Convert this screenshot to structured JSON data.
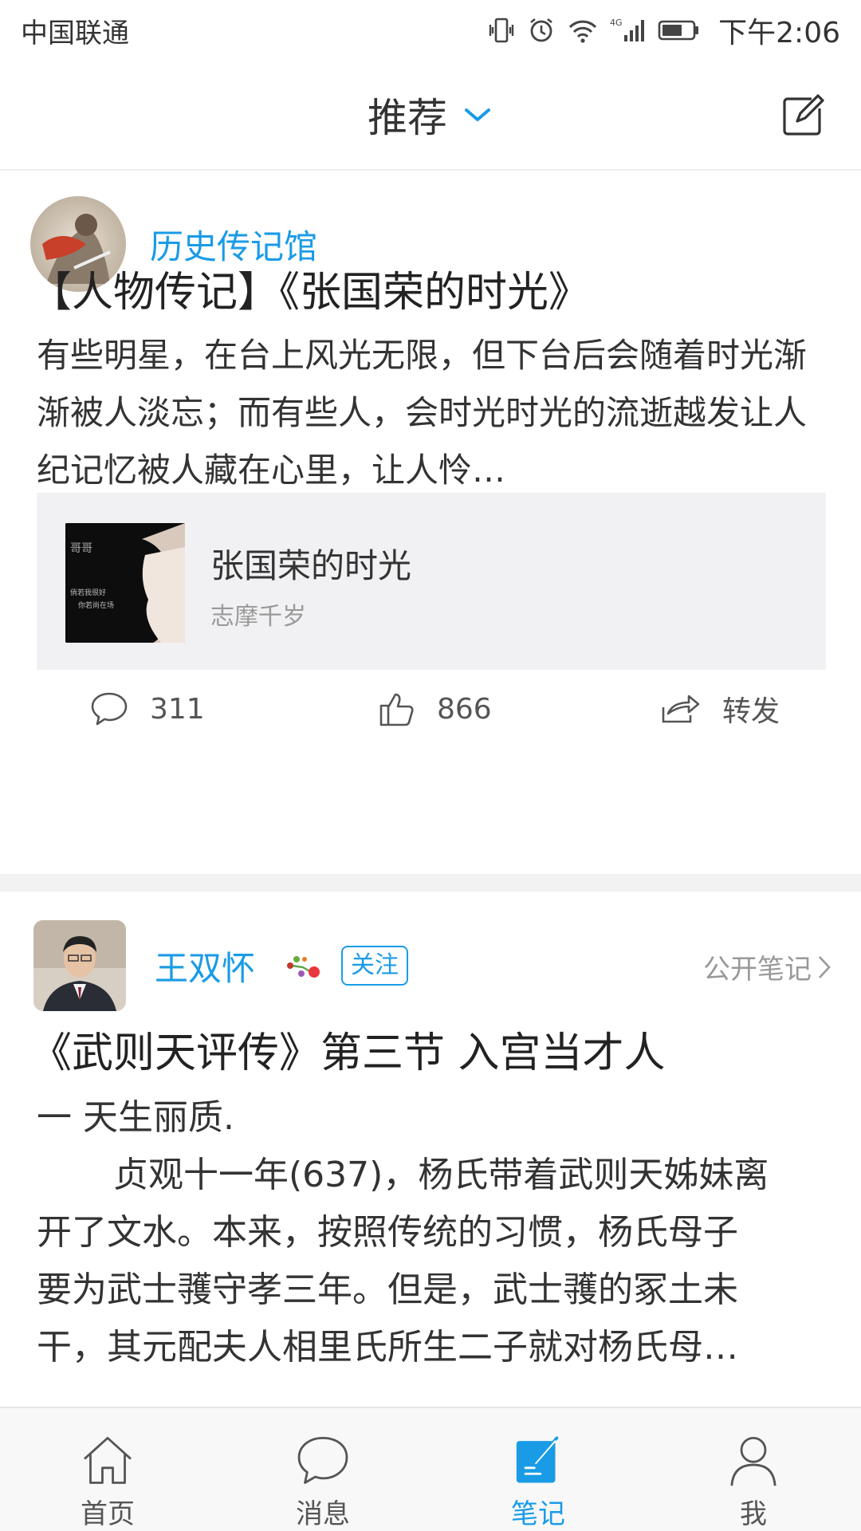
{
  "status_bar": {
    "carrier": "中国联通",
    "network": "4G",
    "time": "下午2:06"
  },
  "header": {
    "title": "推荐",
    "dropdown_icon": "chevron-down-icon",
    "compose_icon": "compose-icon"
  },
  "colors": {
    "accent": "#1a9be6",
    "text": "#222222",
    "muted": "#999999",
    "separator": "#f2f2f2",
    "card_bg": "#f1f1f3"
  },
  "feed": [
    {
      "author": "历史传记馆",
      "title": "【人物传记】《张国荣的时光》",
      "excerpt": "有些明星，在台上风光无限，但下台后会随着时光渐渐被人淡忘；而有些人，会时光时光的流逝越发让人纪记忆被人藏在心里，让人怜…",
      "music": {
        "title": "张国荣的时光",
        "artist": "志摩千岁",
        "cover_title": "哥哥",
        "cover_line_1": "倘若我很好",
        "cover_line_2": "你若尚在场"
      },
      "comments": "311",
      "likes": "866",
      "share_label": "转发"
    },
    {
      "author": "王双怀",
      "follow_label": "关注",
      "public_note_label": "公开笔记",
      "title": "《武则天评传》第三节  入宫当才人",
      "body_lines": [
        "一    天生丽质.",
        "贞观十一年(637)，杨氏带着武则天姊妹离",
        "开了文水。本来，按照传统的习惯，杨氏母子",
        "要为武士彟守孝三年。但是，武士彟的冢土未",
        "干，其元配夫人相里氏所生二子就对杨氏母…"
      ]
    }
  ],
  "bottom_nav": [
    {
      "label": "首页",
      "icon": "home-icon",
      "active": false
    },
    {
      "label": "消息",
      "icon": "message-icon",
      "active": false
    },
    {
      "label": "笔记",
      "icon": "note-icon",
      "active": true
    },
    {
      "label": "我",
      "icon": "profile-icon",
      "active": false
    }
  ]
}
